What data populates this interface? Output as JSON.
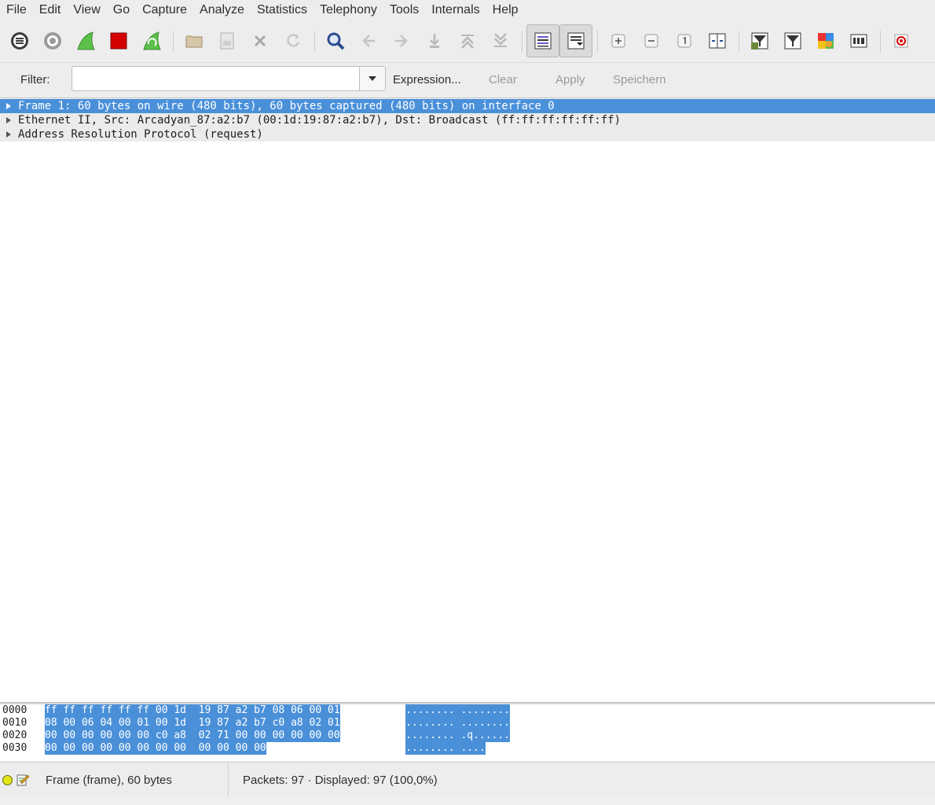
{
  "menubar": [
    "File",
    "Edit",
    "View",
    "Go",
    "Capture",
    "Analyze",
    "Statistics",
    "Telephony",
    "Tools",
    "Internals",
    "Help"
  ],
  "toolbar": {
    "icons": [
      "interfaces-icon",
      "options-icon",
      "start-capture-icon",
      "stop-capture-icon",
      "restart-capture-icon",
      "open-file-icon",
      "save-file-icon",
      "close-file-icon",
      "reload-icon",
      "find-icon",
      "go-back-icon",
      "go-forward-icon",
      "go-to-packet-icon",
      "first-packet-icon",
      "last-packet-icon",
      "colorize-icon",
      "autoscroll-icon",
      "zoom-in-icon",
      "zoom-out-icon",
      "normal-size-icon",
      "resize-columns-icon",
      "capture-filters-icon",
      "display-filters-icon",
      "coloring-rules-icon",
      "preferences-icon",
      "help-icon"
    ],
    "accent_colors": {
      "shark_green": "#5cc14a",
      "stop_red": "#d40000",
      "find_blue": "#2a4d8f"
    }
  },
  "filter": {
    "label": "Filter:",
    "value": "",
    "expression_label": "Expression...",
    "clear_label": "Clear",
    "apply_label": "Apply",
    "save_label": "Speichern"
  },
  "details": [
    {
      "text": "Frame 1: 60 bytes on wire (480 bits), 60 bytes captured (480 bits) on interface 0",
      "selected": true
    },
    {
      "text": "Ethernet II, Src: Arcadyan_87:a2:b7 (00:1d:19:87:a2:b7), Dst: Broadcast (ff:ff:ff:ff:ff:ff)",
      "selected": false
    },
    {
      "text": "Address Resolution Protocol (request)",
      "selected": false
    }
  ],
  "hex": [
    {
      "offset": "0000",
      "bytes": "ff ff ff ff ff ff 00 1d  19 87 a2 b7 08 06 00 01",
      "ascii": "........ ........"
    },
    {
      "offset": "0010",
      "bytes": "08 00 06 04 00 01 00 1d  19 87 a2 b7 c0 a8 02 01",
      "ascii": "........ ........"
    },
    {
      "offset": "0020",
      "bytes": "00 00 00 00 00 00 c0 a8  02 71 00 00 00 00 00 00",
      "ascii": "........ .q......"
    },
    {
      "offset": "0030",
      "bytes": "00 00 00 00 00 00 00 00  00 00 00 00",
      "ascii": "........ ...."
    }
  ],
  "status": {
    "field_info": "Frame (frame), 60 bytes",
    "packets": "Packets: 97 · Displayed: 97 (100,0%)"
  },
  "colors": {
    "selection": "#4a90d9",
    "tree_row_bg": "#ebebeb",
    "status_led": "#e4e41a"
  }
}
